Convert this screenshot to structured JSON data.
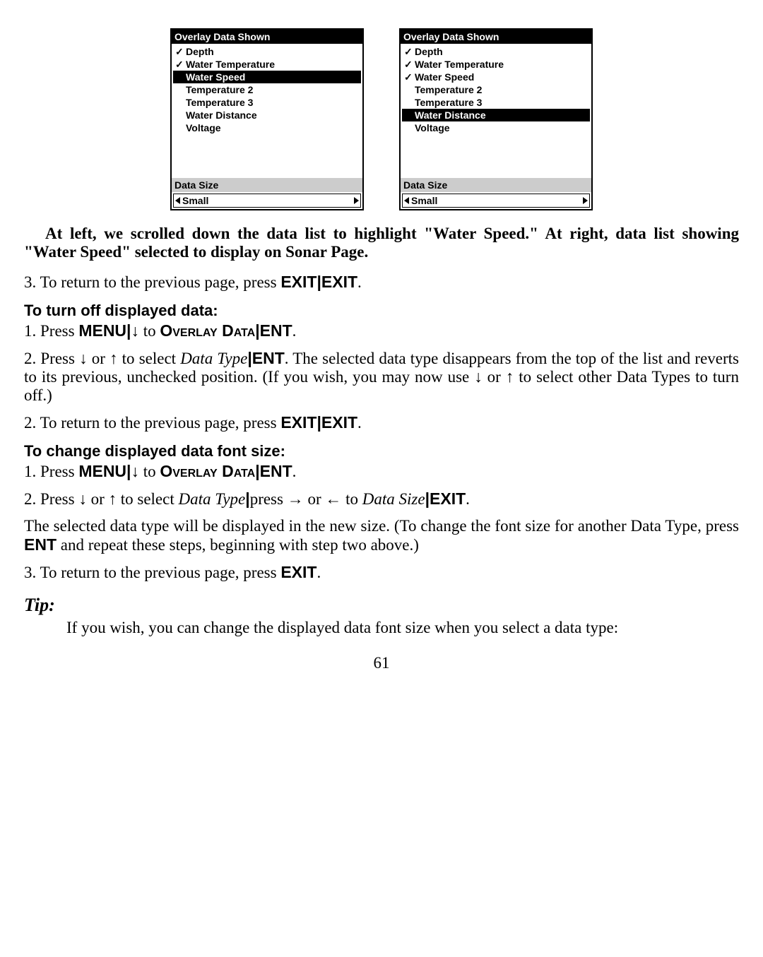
{
  "dialogs": [
    {
      "title": "Overlay Data Shown",
      "items": [
        {
          "label": "Depth",
          "checked": true,
          "selected": false
        },
        {
          "label": "Water Temperature",
          "checked": true,
          "selected": false
        },
        {
          "label": "Water Speed",
          "checked": false,
          "selected": true
        },
        {
          "label": "Temperature 2",
          "checked": false,
          "selected": false
        },
        {
          "label": "Temperature 3",
          "checked": false,
          "selected": false
        },
        {
          "label": "Water Distance",
          "checked": false,
          "selected": false
        },
        {
          "label": "Voltage",
          "checked": false,
          "selected": false
        }
      ],
      "sizeLabel": "Data Size",
      "sizeValue": "Small"
    },
    {
      "title": "Overlay Data Shown",
      "items": [
        {
          "label": "Depth",
          "checked": true,
          "selected": false
        },
        {
          "label": "Water Temperature",
          "checked": true,
          "selected": false
        },
        {
          "label": "Water Speed",
          "checked": true,
          "selected": false
        },
        {
          "label": "Temperature 2",
          "checked": false,
          "selected": false
        },
        {
          "label": "Temperature 3",
          "checked": false,
          "selected": false
        },
        {
          "label": "Water Distance",
          "checked": false,
          "selected": true
        },
        {
          "label": "Voltage",
          "checked": false,
          "selected": false
        }
      ],
      "sizeLabel": "Data Size",
      "sizeValue": "Small"
    }
  ],
  "caption": "At left, we scrolled down the data list to highlight \"Water Speed.\" At right, data list showing \"Water Speed\" selected to display on Sonar Page.",
  "step3a_pre": "3. To return to the previous page, press ",
  "exit": "EXIT",
  "sep": "|",
  "h_turnoff": "To turn off displayed data:",
  "s1_pre": "1. Press ",
  "menu": "MENU",
  "arrow_down": "↓",
  "s1_mid": " to ",
  "overlay": "Overlay Data",
  "ent": "ENT",
  "s2a": "2. Press ",
  "arrow_up": "↑",
  "s2b": " or ",
  "s2c": " to select ",
  "datatype": "Data Type",
  "s2d": ". The selected data type disappears from the top of the list and reverts to its previous, unchecked position. (If you wish, you may now use ",
  "s2e": " to select other Data Types to turn off.)",
  "step2ret": "2. To return to the previous page, press ",
  "h_font": "To change displayed data font size:",
  "s4a": "2. Press ",
  "s4b": " to select ",
  "s4c": "press ",
  "arrow_r": "→",
  "arrow_l": "←",
  "s4d": " or ",
  "s4e": " to ",
  "datasize": "Data Size",
  "para_a": "The selected data type will be displayed in the new size. (To change the font size for another Data Type, press ",
  "para_b": " and repeat these steps, beginning with step two above.)",
  "step3b": "3. To return to the previous page, press ",
  "tip": "Tip:",
  "tipbody": "If you wish, you can change the displayed data font size when you select a data type:",
  "page": "61"
}
